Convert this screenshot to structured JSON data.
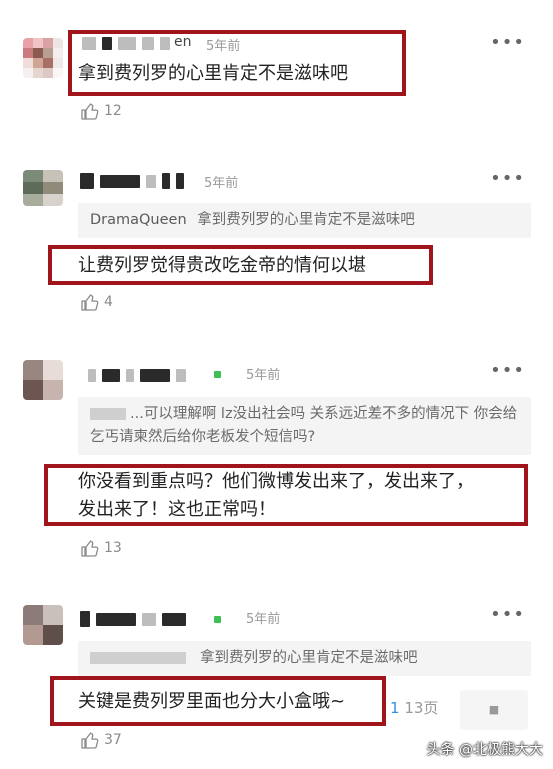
{
  "comments": [
    {
      "name_tail": "en",
      "time": "5年前",
      "body": "拿到费列罗的心里肯定不是滋味吧",
      "likes": "12"
    },
    {
      "time": "5年前",
      "quote_name": "DramaQueen",
      "quote_text": "拿到费列罗的心里肯定不是滋味吧",
      "body": "让费列罗觉得贵改吃金帝的情何以堪",
      "likes": "4"
    },
    {
      "time": "5年前",
      "quote_text": "...可以理解啊 lz没出社会吗 关系远近差不多的情况下 你会给乞丐请柬然后给你老板发个短信吗?",
      "body_line1": "你没看到重点吗？他们微博发出来了，发出来了，",
      "body_line2": "发出来了！这也正常吗！",
      "likes": "13"
    },
    {
      "time": "5年前",
      "quote_text": "拿到费列罗的心里肯定不是滋味吧",
      "body": "关键是费列罗里面也分大小盒哦~",
      "likes": "37"
    }
  ],
  "more_label": "•••",
  "pager": {
    "current": "1",
    "total_label": "13页"
  },
  "watermark": "头条 @北极熊大大",
  "colors": {
    "highlight_box": "#a0151b",
    "quote_bg": "#f4f4f4",
    "time_text": "#9a9a9a"
  }
}
